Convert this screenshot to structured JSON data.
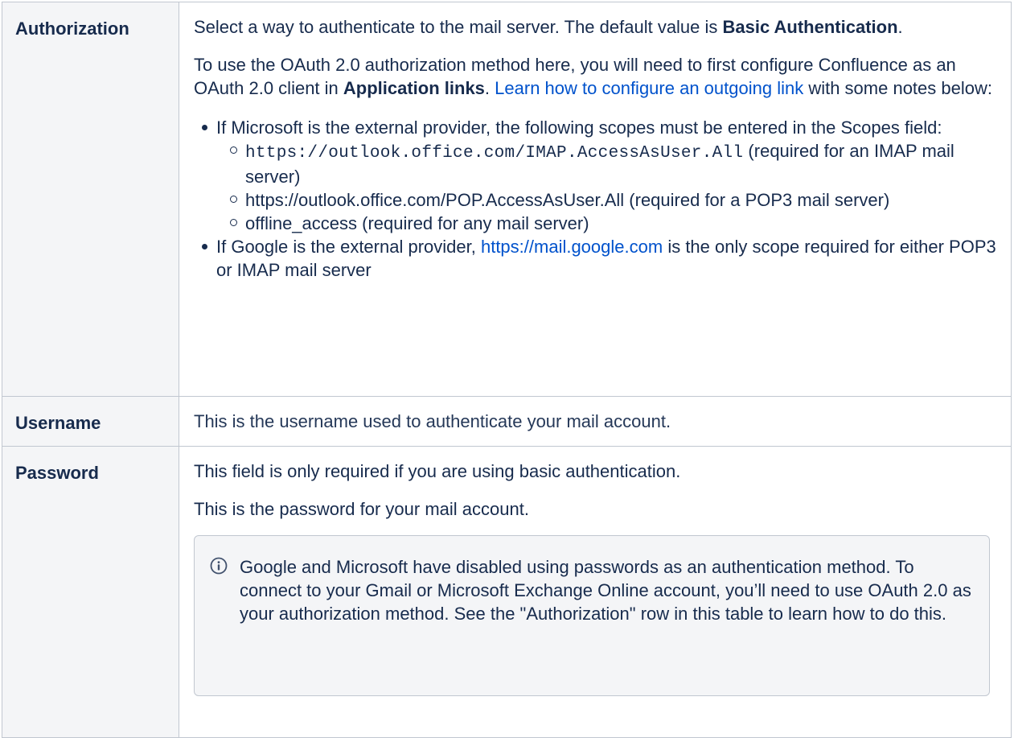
{
  "rows": {
    "authorization": {
      "label": "Authorization",
      "intro_pre": "Select a way to authenticate to the mail server. The default value is ",
      "intro_bold": "Basic Authentication",
      "intro_post": ".",
      "p2_pre": "To use the OAuth 2.0 authorization method here, you will need to first configure Confluence as an OAuth 2.0 client in ",
      "p2_bold": "Application links",
      "p2_mid": ". ",
      "p2_link": "Learn how to configure an outgoing link",
      "p2_post": " with some notes below:",
      "bullet1_text": "If Microsoft is the external provider, the following scopes must be entered in the Scopes field:",
      "scopes": [
        {
          "code": "https://outlook.office.com/IMAP.AccessAsUser.All",
          "note": " (required for an IMAP mail server)"
        },
        {
          "text": "https://outlook.office.com/POP.AccessAsUser.All (required for a POP3 mail server)"
        },
        {
          "text": "offline_access (required for any mail server)"
        }
      ],
      "bullet2_pre": "If Google is the external provider, ",
      "bullet2_link": "https://mail.google.com",
      "bullet2_post": " is the only scope required for either POP3 or IMAP mail server"
    },
    "username": {
      "label": "Username",
      "text": "This is the username used to authenticate your mail account."
    },
    "password": {
      "label": "Password",
      "p1": "This field is only required if you are using basic authentication.",
      "p2": "This is the password for your mail account.",
      "note": "Google and Microsoft have disabled using passwords as an authentication method. To connect to your Gmail or Microsoft Exchange Online account, you’ll need to use OAuth 2.0 as your authorization method. See the \"Authorization\" row in this table to learn how to do this.",
      "note_icon": "info-icon"
    }
  }
}
